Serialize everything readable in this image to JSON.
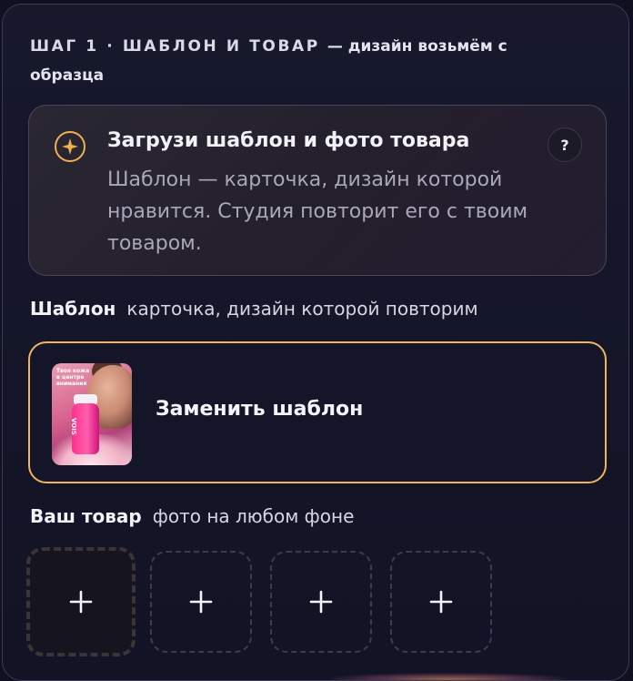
{
  "header": {
    "step_title": "ШАГ 1 · ШАБЛОН И ТОВАР",
    "step_subtitle": "— дизайн возьмём с образца"
  },
  "info_card": {
    "icon": "sparkle-icon",
    "title": "Загрузи шаблон и фото товара",
    "text": "Шаблон — карточка, дизайн которой нравится. Студия повторит его с твоим товаром.",
    "help_label": "?"
  },
  "template_section": {
    "label": "Шаблон",
    "hint": "карточка, дизайн которой повторим",
    "thumbnail_text": "Твоя кожа в центре внимания",
    "thumbnail_brand": "VOIS",
    "action_label": "Заменить шаблон"
  },
  "product_section": {
    "label": "Ваш товар",
    "hint": "фото на любом фоне",
    "slots": [
      {
        "icon": "plus-icon"
      },
      {
        "icon": "plus-icon"
      },
      {
        "icon": "plus-icon"
      },
      {
        "icon": "plus-icon"
      }
    ]
  },
  "colors": {
    "accent": "#f0b45c",
    "panel_bg": "#15162a",
    "card_bg": "#262230"
  }
}
